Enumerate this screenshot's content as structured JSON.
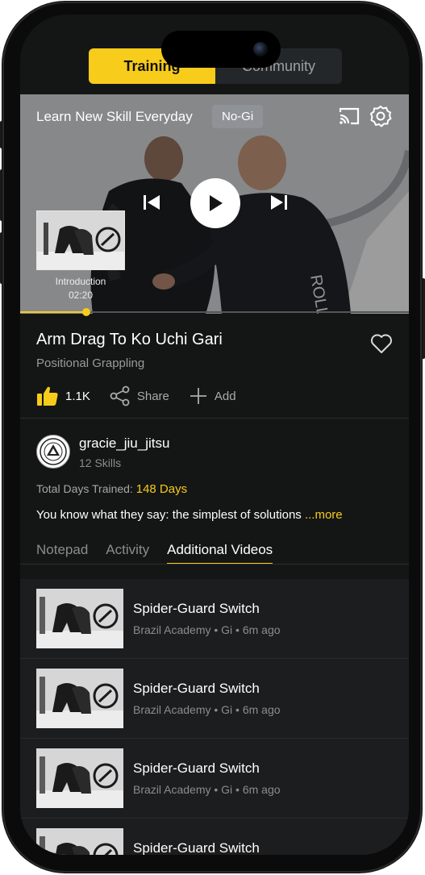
{
  "top_tabs": {
    "training": "Training",
    "community": "Community"
  },
  "video": {
    "title": "Learn New Skill Everyday",
    "tag": "No-Gi",
    "progress_fraction": 0.17,
    "intro": {
      "label": "Introduction",
      "time": "02:20"
    }
  },
  "lesson": {
    "title": "Arm Drag To Ko Uchi Gari",
    "category": "Positional Grappling",
    "likes": "1.1K",
    "share": "Share",
    "add": "Add"
  },
  "instructor": {
    "name": "gracie_jiu_jitsu",
    "skills": "12 Skills",
    "days_label": "Total Days Trained:",
    "days_value": "148 Days",
    "description": "You know what they say: the simplest of solutions",
    "more": "...more"
  },
  "detail_tabs": [
    "Notepad",
    "Activity",
    "Additional Videos"
  ],
  "additional_videos": [
    {
      "title": "Spider-Guard Switch",
      "meta": "Brazil Academy • Gi • 6m ago"
    },
    {
      "title": "Spider-Guard Switch",
      "meta": "Brazil Academy • Gi • 6m ago"
    },
    {
      "title": "Spider-Guard Switch",
      "meta": "Brazil Academy • Gi • 6m ago"
    },
    {
      "title": "Spider-Guard Switch",
      "meta": ""
    }
  ],
  "colors": {
    "accent": "#f7cc1a",
    "background": "#141515"
  },
  "icons": [
    "cast-icon",
    "gear-icon",
    "play-icon",
    "previous-icon",
    "next-icon",
    "heart-icon",
    "thumbs-up-icon",
    "share-icon",
    "plus-icon"
  ]
}
